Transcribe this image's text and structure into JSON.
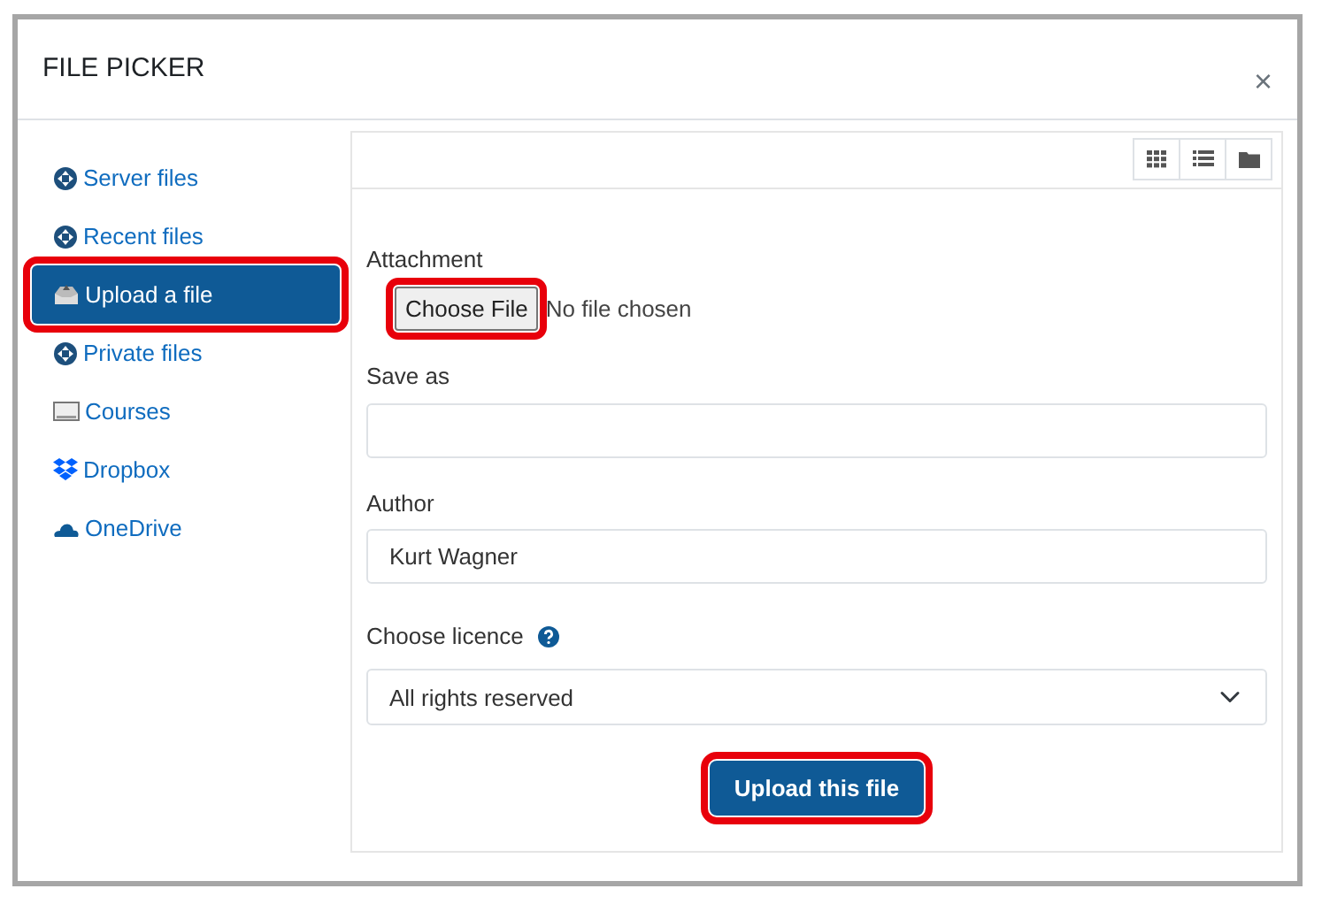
{
  "dialog": {
    "title": "FILE PICKER",
    "close": "×"
  },
  "sidebar": {
    "items": [
      {
        "label": "Server files",
        "kind": "repo",
        "selected": false,
        "highlighted": false
      },
      {
        "label": "Recent files",
        "kind": "repo",
        "selected": false,
        "highlighted": false
      },
      {
        "label": "Upload a file",
        "kind": "upload",
        "selected": true,
        "highlighted": true
      },
      {
        "label": "Private files",
        "kind": "repo",
        "selected": false,
        "highlighted": false
      },
      {
        "label": "Courses",
        "kind": "courses",
        "selected": false,
        "highlighted": false
      },
      {
        "label": "Dropbox",
        "kind": "dropbox",
        "selected": false,
        "highlighted": false
      },
      {
        "label": "OneDrive",
        "kind": "onedrive",
        "selected": false,
        "highlighted": false
      }
    ]
  },
  "view_buttons": [
    {
      "kind": "icons"
    },
    {
      "kind": "list"
    },
    {
      "kind": "folder"
    }
  ],
  "form": {
    "attachment": {
      "label": "Attachment",
      "button": "Choose File",
      "status": "No file chosen",
      "highlighted": true
    },
    "save_as": {
      "label": "Save as"
    },
    "author": {
      "label": "Author",
      "value": "Kurt Wagner"
    },
    "licence": {
      "label": "Choose licence",
      "value": "All rights reserved"
    },
    "submit": {
      "label": "Upload this file",
      "highlighted": true
    }
  }
}
